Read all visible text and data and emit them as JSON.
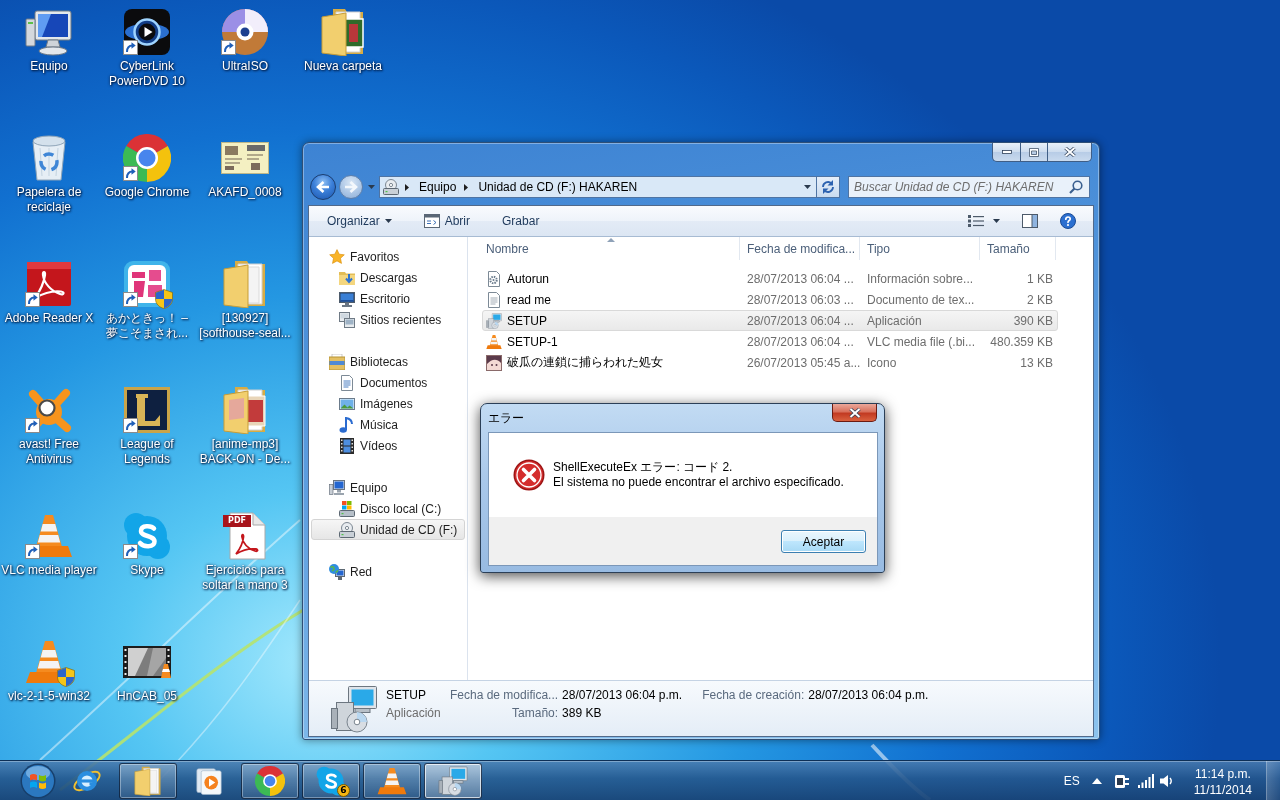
{
  "desktop": {
    "icon_columns": [
      [
        {
          "label": "Equipo",
          "kind": "computer",
          "shortcut": false,
          "shield": false
        },
        {
          "label": "Papelera de reciclaje",
          "kind": "recycle-bin",
          "shortcut": false,
          "shield": false
        },
        {
          "label": "Adobe Reader X",
          "kind": "reader",
          "shortcut": true,
          "shield": false
        },
        {
          "label": "avast! Free Antivirus",
          "kind": "antivirus",
          "shortcut": true,
          "shield": false
        },
        {
          "label": "VLC media player",
          "kind": "vlc",
          "shortcut": true,
          "shield": false
        },
        {
          "label": "vlc-2-1-5-win32",
          "kind": "vlc",
          "shortcut": false,
          "shield": true
        }
      ],
      [
        {
          "label": "CyberLink PowerDVD 10",
          "kind": "dvd-player",
          "shortcut": true,
          "shield": false
        },
        {
          "label": "Google Chrome",
          "kind": "browser",
          "shortcut": true,
          "shield": false
        },
        {
          "label": "あかときっ！ – 夢こそまされ...",
          "kind": "app-art",
          "shortcut": true,
          "shield": true
        },
        {
          "label": "League of Legends",
          "kind": "game",
          "shortcut": true,
          "shield": false
        },
        {
          "label": "Skype",
          "kind": "skype",
          "shortcut": true,
          "shield": false
        },
        {
          "label": "HnCAB_05",
          "kind": "video",
          "shortcut": false,
          "shield": false
        }
      ],
      [
        {
          "label": "UltraISO",
          "kind": "disc",
          "shortcut": true,
          "shield": false
        },
        {
          "label": "AKAFD_0008",
          "kind": "thumbnail",
          "shortcut": false,
          "shield": false
        },
        {
          "label": "[130927] [softhouse-seal...",
          "kind": "folder",
          "shortcut": false,
          "shield": false
        },
        {
          "label": "[anime-mp3] BACK-ON - De...",
          "kind": "folder-art",
          "shortcut": false,
          "shield": false
        },
        {
          "label": "Ejercicios para soltar la mano 3",
          "kind": "pdf-file",
          "icon_text": "PDF",
          "shortcut": false,
          "shield": false
        }
      ],
      [
        {
          "label": "Nueva carpeta",
          "kind": "folder-photo",
          "shortcut": false,
          "shield": false
        }
      ]
    ]
  },
  "explorer": {
    "address": {
      "crumbs": [
        "Equipo",
        "Unidad de CD (F:) HAKAREN"
      ]
    },
    "search": {
      "placeholder": "Buscar Unidad de CD (F:) HAKAREN"
    },
    "toolbar": [
      {
        "label": "Organizar",
        "kind": "menu"
      },
      {
        "label": "Abrir",
        "kind": "open"
      },
      {
        "label": "Grabar",
        "kind": "plain"
      }
    ],
    "navigation": [
      {
        "label": "Favoritos",
        "kind": "star",
        "selected": false,
        "children": [
          {
            "label": "Descargas",
            "kind": "downloads",
            "selected": false
          },
          {
            "label": "Escritorio",
            "kind": "desktop",
            "selected": false
          },
          {
            "label": "Sitios recientes",
            "kind": "recent",
            "selected": false
          }
        ]
      },
      {
        "label": "Bibliotecas",
        "kind": "library",
        "selected": false,
        "children": [
          {
            "label": "Documentos",
            "kind": "documents",
            "selected": false
          },
          {
            "label": "Imágenes",
            "kind": "pictures",
            "selected": false
          },
          {
            "label": "Música",
            "kind": "music",
            "selected": false
          },
          {
            "label": "Vídeos",
            "kind": "videos",
            "selected": false
          }
        ]
      },
      {
        "label": "Equipo",
        "kind": "computer",
        "selected": false,
        "children": [
          {
            "label": "Disco local (C:)",
            "kind": "local-disk",
            "selected": false
          },
          {
            "label": "Unidad de CD (F:)",
            "kind": "cd-drive",
            "selected": true
          }
        ]
      },
      {
        "label": "Red",
        "kind": "network",
        "selected": false
      }
    ],
    "columns": [
      {
        "label": "Nombre",
        "sorted": true
      },
      {
        "label": "Fecha de modifica...",
        "sorted": false
      },
      {
        "label": "Tipo",
        "sorted": false
      },
      {
        "label": "Tamaño",
        "sorted": false
      }
    ],
    "files": [
      {
        "name": "Autorun",
        "kind": "settings",
        "modified": "28/07/2013 06:04 ...",
        "type": "Información sobre...",
        "size": "1 KB",
        "selected": false
      },
      {
        "name": "read me",
        "kind": "text",
        "modified": "28/07/2013 06:03 ...",
        "type": "Documento de tex...",
        "size": "2 KB",
        "selected": false
      },
      {
        "name": "SETUP",
        "kind": "installer",
        "modified": "28/07/2013 06:04 ...",
        "type": "Aplicación",
        "size": "390 KB",
        "selected": true
      },
      {
        "name": "SETUP-1",
        "kind": "vlc",
        "modified": "28/07/2013 06:04 ...",
        "type": "VLC media file (.bi...",
        "size": "480.359 KB",
        "selected": false
      },
      {
        "name": "破瓜の連鎖に捕らわれた処女",
        "kind": "image",
        "modified": "26/07/2013 05:45 a...",
        "type": "Icono",
        "size": "13 KB",
        "selected": false
      }
    ],
    "details": {
      "name": "SETUP",
      "kind": "installer",
      "type": "Aplicación",
      "fields": [
        {
          "label": "Fecha de modifica...",
          "value": "28/07/2013 06:04 p.m."
        },
        {
          "label": "Tamaño:",
          "value": "389 KB"
        },
        {
          "label": "Fecha de creación:",
          "value": "28/07/2013 06:04 p.m."
        }
      ]
    }
  },
  "dialog": {
    "title": "エラー",
    "message": [
      "ShellExecuteEx エラー: コード 2.",
      "El sistema no puede encontrar el archivo especificado."
    ],
    "buttons": [
      {
        "label": "Aceptar",
        "default": true
      }
    ]
  },
  "taskbar": {
    "items": [
      {
        "kind": "ie",
        "running": false,
        "active": false
      },
      {
        "kind": "explorer",
        "running": true,
        "active": false
      },
      {
        "kind": "media-player",
        "running": false,
        "active": false
      },
      {
        "kind": "chrome",
        "running": true,
        "active": false
      },
      {
        "kind": "skype",
        "running": true,
        "active": false,
        "badge": "6"
      },
      {
        "kind": "vlc",
        "running": true,
        "active": false
      },
      {
        "kind": "installer",
        "running": true,
        "active": true
      }
    ],
    "language": "ES",
    "time": "11:14 p.m.",
    "date": "11/11/2014"
  }
}
